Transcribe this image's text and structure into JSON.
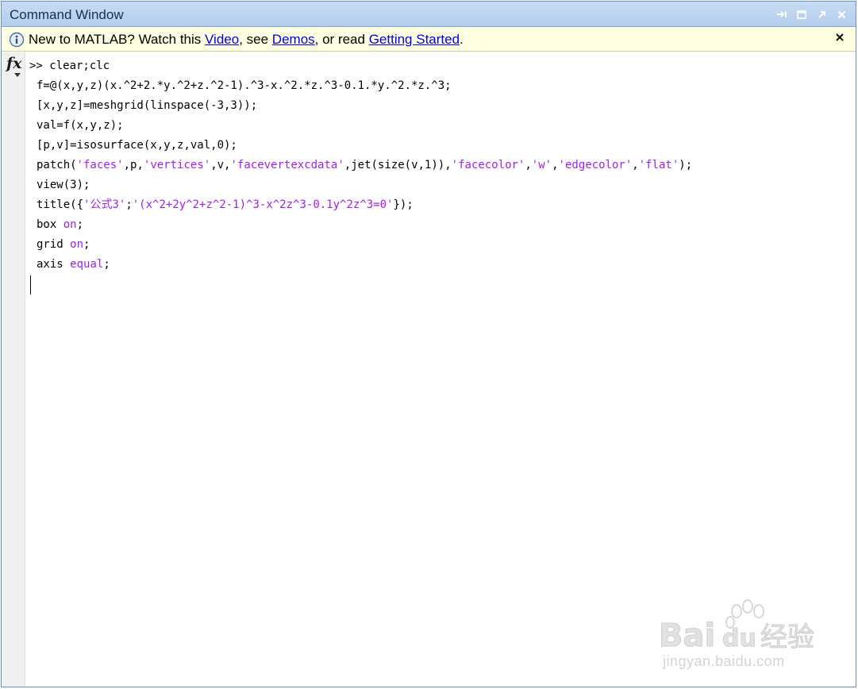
{
  "window": {
    "title": "Command Window",
    "controls": [
      "undock-icon",
      "maximize-icon",
      "popout-icon",
      "close-icon"
    ]
  },
  "infobar": {
    "prefix": "New to MATLAB? Watch this ",
    "video_link": "Video",
    "mid1": ", see ",
    "demos_link": "Demos",
    "mid2": ", or read ",
    "getting_started_link": "Getting Started",
    "suffix": ".",
    "close_glyph": "×"
  },
  "fx": {
    "label": "fx"
  },
  "console": {
    "prompt": ">>",
    "lines": [
      {
        "segments": [
          {
            "text": ">> clear;clc",
            "color": "#000000"
          }
        ]
      },
      {
        "segments": [
          {
            "text": "f=@(x,y,z)(x.^2+2.*y.^2+z.^2-1).^3-x.^2.*z.^3-0.1.*y.^2.*z.^3;",
            "color": "#000000"
          }
        ]
      },
      {
        "segments": [
          {
            "text": "[x,y,z]=meshgrid(linspace(-3,3));",
            "color": "#000000"
          }
        ]
      },
      {
        "segments": [
          {
            "text": "val=f(x,y,z);",
            "color": "#000000"
          }
        ]
      },
      {
        "segments": [
          {
            "text": "[p,v]=isosurface(x,y,z,val,0);",
            "color": "#000000"
          }
        ]
      },
      {
        "segments": [
          {
            "text": "patch(",
            "color": "#000000"
          },
          {
            "text": "'faces'",
            "color": "#a020f0"
          },
          {
            "text": ",p,",
            "color": "#000000"
          },
          {
            "text": "'vertices'",
            "color": "#a020f0"
          },
          {
            "text": ",v,",
            "color": "#000000"
          },
          {
            "text": "'facevertexcdata'",
            "color": "#a020f0"
          },
          {
            "text": ",jet(size(v,1)),",
            "color": "#000000"
          },
          {
            "text": "'facecolor'",
            "color": "#a020f0"
          },
          {
            "text": ",",
            "color": "#000000"
          },
          {
            "text": "'w'",
            "color": "#a020f0"
          },
          {
            "text": ",",
            "color": "#000000"
          },
          {
            "text": "'edgecolor'",
            "color": "#a020f0"
          },
          {
            "text": ",",
            "color": "#000000"
          },
          {
            "text": "'flat'",
            "color": "#a020f0"
          },
          {
            "text": ");",
            "color": "#000000"
          }
        ]
      },
      {
        "segments": [
          {
            "text": "view(3);",
            "color": "#000000"
          }
        ]
      },
      {
        "segments": [
          {
            "text": "title({",
            "color": "#000000"
          },
          {
            "text": "'公式3'",
            "color": "#a020f0"
          },
          {
            "text": ";",
            "color": "#000000"
          },
          {
            "text": "'(x^2+2y^2+z^2-1)^3-x^2z^3-0.1y^2z^3=0'",
            "color": "#a020f0"
          },
          {
            "text": "});",
            "color": "#000000"
          }
        ]
      },
      {
        "segments": [
          {
            "text": "box ",
            "color": "#000000"
          },
          {
            "text": "on",
            "color": "#a020f0"
          },
          {
            "text": ";",
            "color": "#000000"
          }
        ]
      },
      {
        "segments": [
          {
            "text": "grid ",
            "color": "#000000"
          },
          {
            "text": "on",
            "color": "#a020f0"
          },
          {
            "text": ";",
            "color": "#000000"
          }
        ]
      },
      {
        "segments": [
          {
            "text": "axis ",
            "color": "#000000"
          },
          {
            "text": "equal",
            "color": "#a020f0"
          },
          {
            "text": ";",
            "color": "#000000"
          }
        ]
      }
    ]
  },
  "watermark": {
    "brand": "Bai du 经验",
    "url": "jingyan.baidu.com"
  },
  "colors": {
    "title_bg": "#b3cdec",
    "info_bg": "#ffffe1",
    "link": "#0000ee",
    "string": "#a020f0",
    "gutter": "#f0f0f0"
  }
}
